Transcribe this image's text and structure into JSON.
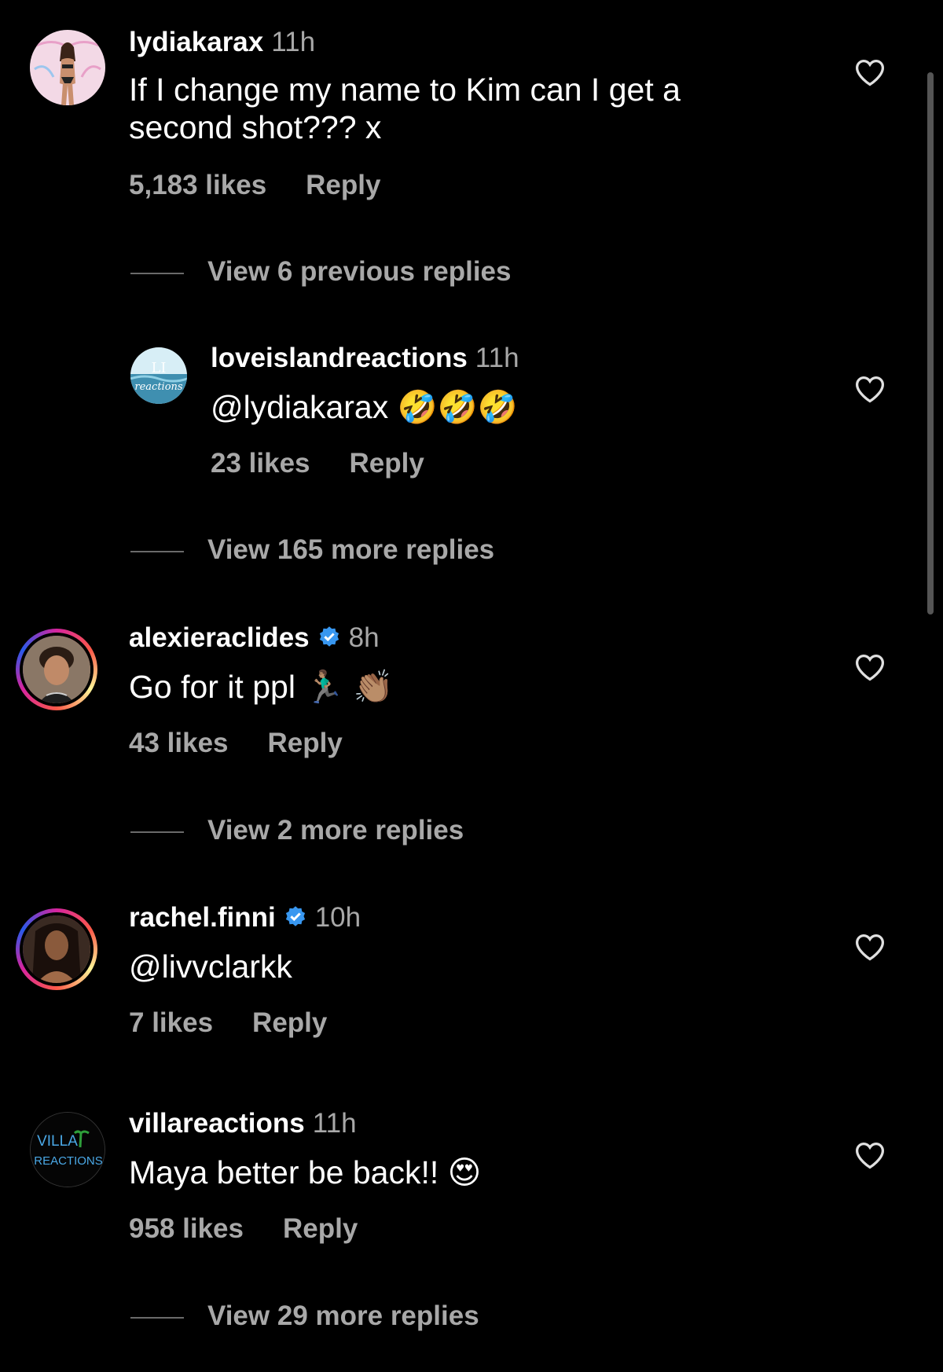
{
  "comments": [
    {
      "username": "lydiakarax",
      "time": "11h",
      "text": "If I change my name to Kim can I get a second shot??? x",
      "likes": "5,183 likes",
      "reply_label": "Reply",
      "verified": false,
      "avatar": "bikini-model-photo"
    },
    {
      "username": "loveislandreactions",
      "time": "11h",
      "text": "@lydiakarax 🤣🤣🤣",
      "likes": "23 likes",
      "reply_label": "Reply",
      "verified": false,
      "avatar": "beach-logo"
    },
    {
      "username": "alexieraclides",
      "time": "8h",
      "text": "Go for it ppl 🏃🏽‍♂️ 👏🏽",
      "likes": "43 likes",
      "reply_label": "Reply",
      "verified": true,
      "avatar": "man-portrait-story-ring"
    },
    {
      "username": "rachel.finni",
      "time": "10h",
      "text": "@livvclarkk",
      "likes": "7 likes",
      "reply_label": "Reply",
      "verified": true,
      "avatar": "woman-portrait-story-ring"
    },
    {
      "username": "villareactions",
      "time": "11h",
      "text": "Maya better be back!! 😍",
      "likes": "958 likes",
      "reply_label": "Reply",
      "verified": false,
      "avatar": "villa-reactions-logo",
      "avatar_text_1": "VILLA",
      "avatar_text_2": "REACTIONS"
    }
  ],
  "view_replies": [
    "View 6 previous replies",
    "View 165 more replies",
    "View 2 more replies",
    "View 29 more replies"
  ],
  "colors": {
    "background": "#000000",
    "secondary_text": "#a8a8a8",
    "verified_blue": "#3897f0"
  },
  "icons": {
    "like": "heart-outline-icon",
    "verified": "verified-badge-icon"
  }
}
